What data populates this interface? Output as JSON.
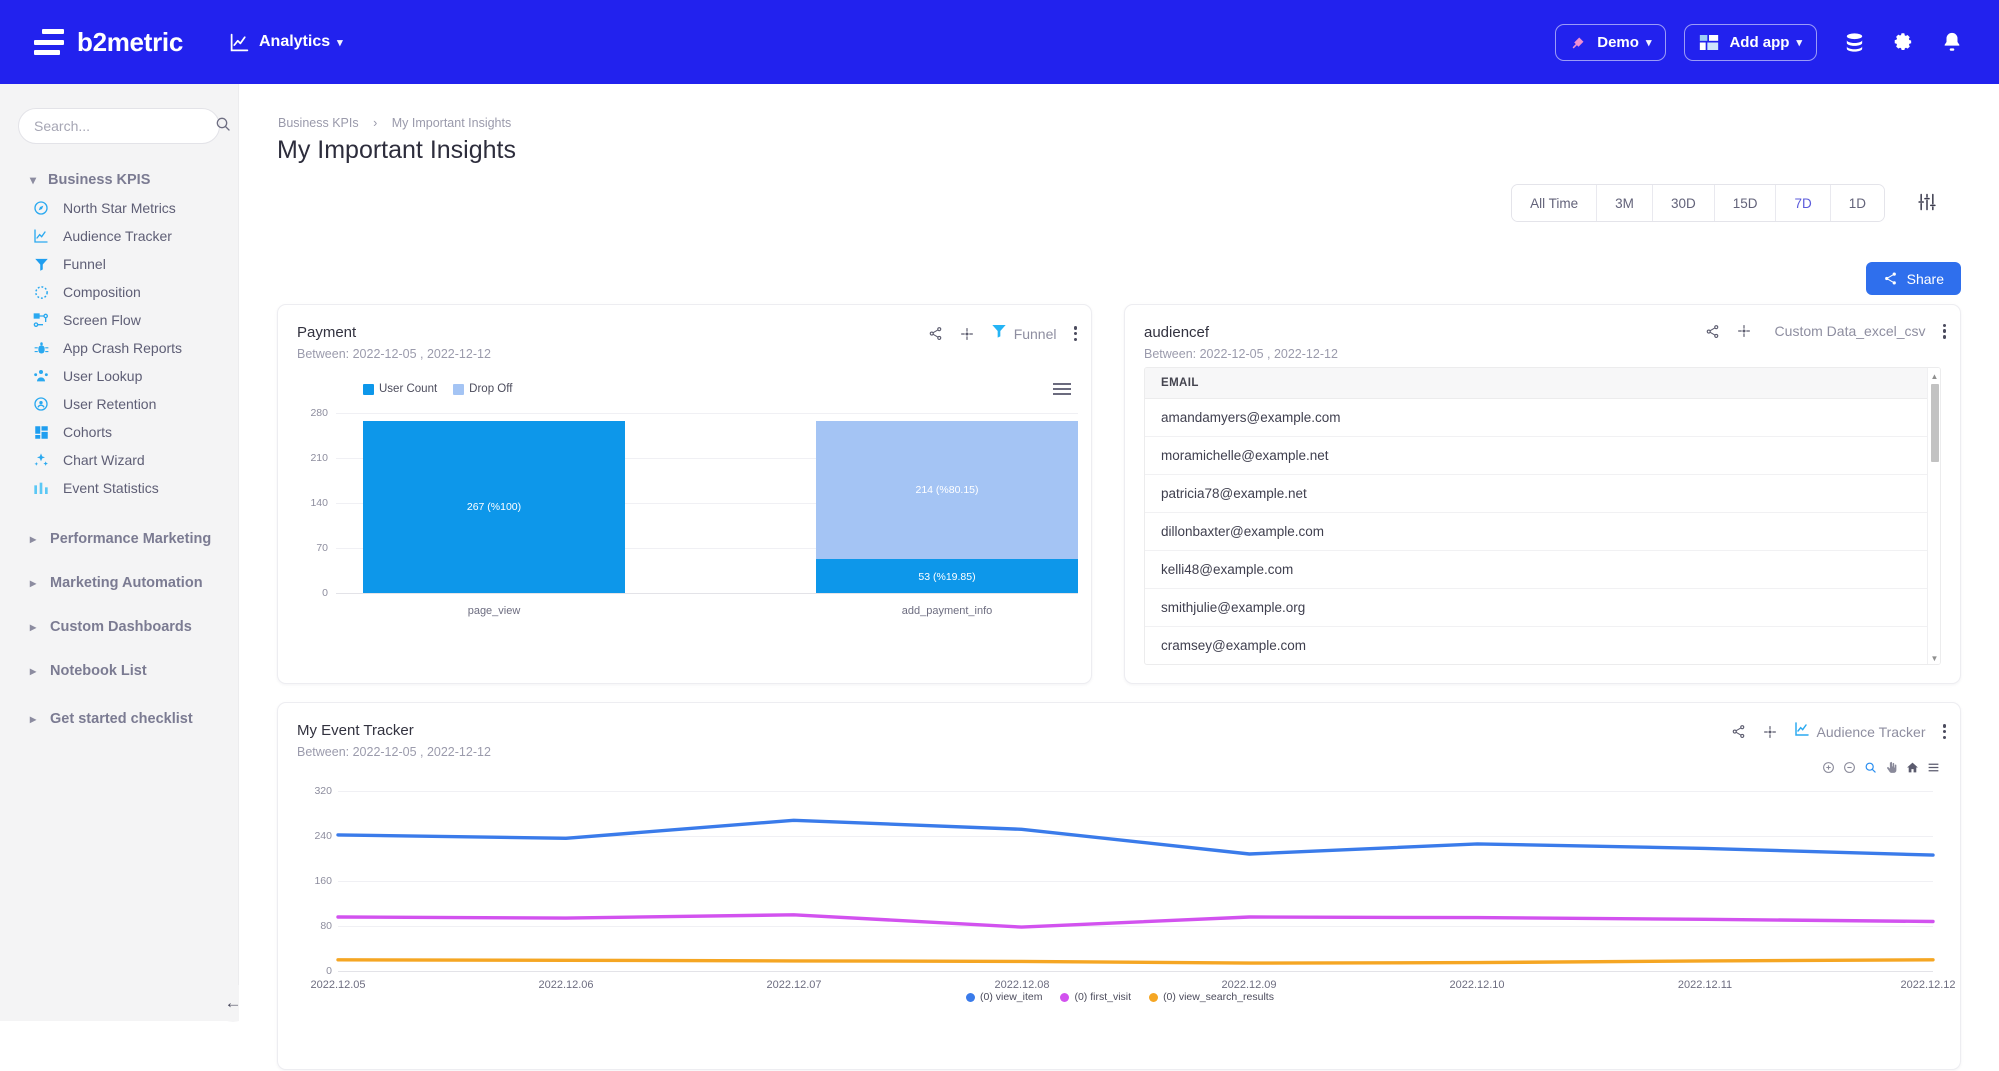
{
  "topbar": {
    "brand": "b2metric",
    "analytics_label": "Analytics",
    "analytics_icon": "line-chart-icon",
    "demo_label": "Demo",
    "demo_icon": "rocket-icon",
    "add_app_label": "Add app",
    "add_app_icon": "apps-grid-icon",
    "database_icon": "database-icon",
    "settings_icon": "gear-icon",
    "notifications_icon": "bell-icon",
    "brand_color": "#2222EE"
  },
  "sidebar": {
    "search_placeholder": "Search...",
    "search_value": "",
    "search_icon": "search-icon",
    "group_label": "Business KPIS",
    "items": [
      {
        "label": "North Star Metrics",
        "icon": "compass-icon"
      },
      {
        "label": "Audience Tracker",
        "icon": "line-chart-icon"
      },
      {
        "label": "Funnel",
        "icon": "funnel-icon"
      },
      {
        "label": "Composition",
        "icon": "composition-icon"
      },
      {
        "label": "Screen Flow",
        "icon": "flow-nodes-icon"
      },
      {
        "label": "App Crash Reports",
        "icon": "bug-icon"
      },
      {
        "label": "User Lookup",
        "icon": "users-icon"
      },
      {
        "label": "User Retention",
        "icon": "user-retention-icon"
      },
      {
        "label": "Cohorts",
        "icon": "cohorts-grid-icon"
      },
      {
        "label": "Chart Wizard",
        "icon": "wizard-sparkle-icon"
      },
      {
        "label": "Event Statistics",
        "icon": "bar-stats-icon"
      }
    ],
    "sections": [
      {
        "label": "Performance Marketing"
      },
      {
        "label": "Marketing Automation"
      },
      {
        "label": "Custom Dashboards"
      },
      {
        "label": "Notebook List"
      },
      {
        "label": "Get started checklist"
      }
    ],
    "collapse_icon": "arrow-left-icon"
  },
  "header": {
    "breadcrumb_root": "Business KPIs",
    "breadcrumb_current": "My Important Insights",
    "title": "My Important Insights",
    "share_label": "Share",
    "share_icon": "share-icon",
    "range_settings_icon": "sliders-icon",
    "ranges": [
      {
        "label": "All Time",
        "active": false
      },
      {
        "label": "3M",
        "active": false
      },
      {
        "label": "30D",
        "active": false
      },
      {
        "label": "15D",
        "active": false
      },
      {
        "label": "7D",
        "active": true
      },
      {
        "label": "1D",
        "active": false
      }
    ],
    "active_range_color": "#5b5bdb"
  },
  "cards": {
    "payment": {
      "title": "Payment",
      "subtitle": "Between: 2022-12-05 , 2022-12-12",
      "type_label": "Funnel",
      "type_icon": "funnel-icon",
      "share_icon": "share-icon",
      "move_icon": "drag-handle-icon",
      "menu_icon": "kebab-menu-icon",
      "chart_menu_icon": "hamburger-menu-icon"
    },
    "audience": {
      "title": "audiencef",
      "subtitle": "Between: 2022-12-05 , 2022-12-12",
      "type_label": "Custom Data_excel_csv",
      "share_icon": "share-icon",
      "move_icon": "drag-handle-icon",
      "menu_icon": "kebab-menu-icon",
      "column_header": "EMAIL",
      "rows": [
        "amandamyers@example.com",
        "moramichelle@example.net",
        "patricia78@example.net",
        "dillonbaxter@example.com",
        "kelli48@example.com",
        "smithjulie@example.org",
        "cramsey@example.com"
      ]
    },
    "events": {
      "title": "My Event Tracker",
      "subtitle": "Between: 2022-12-05 , 2022-12-12",
      "type_label": "Audience Tracker",
      "type_icon": "line-chart-icon",
      "share_icon": "share-icon",
      "move_icon": "drag-handle-icon",
      "menu_icon": "kebab-menu-icon",
      "toolbar_icons": [
        "zoom-in-icon",
        "zoom-out-icon",
        "selection-zoom-icon",
        "panning-icon",
        "reset-home-icon",
        "menu-icon"
      ]
    }
  },
  "chart_data": [
    {
      "type": "bar",
      "title": "Payment",
      "subtitle": "Between: 2022-12-05 , 2022-12-12",
      "categories": [
        "page_view",
        "add_payment_info"
      ],
      "series": [
        {
          "name": "User Count",
          "color": "#0d97ea",
          "values": [
            267,
            53
          ]
        },
        {
          "name": "Drop Off",
          "color": "#a4c4f4",
          "values": [
            0,
            214
          ]
        }
      ],
      "point_labels": [
        {
          "category": "page_view",
          "series": "User Count",
          "text": "267 (%100)"
        },
        {
          "category": "add_payment_info",
          "series": "Drop Off",
          "text": "214 (%80.15)"
        },
        {
          "category": "add_payment_info",
          "series": "User Count",
          "text": "53 (%19.85)"
        }
      ],
      "yticks": [
        0,
        70,
        140,
        210,
        280
      ],
      "ylim": [
        0,
        280
      ],
      "xlabel": "",
      "ylabel": "",
      "grid": true,
      "stacked": true,
      "legend_position": "top-left"
    },
    {
      "type": "line",
      "title": "My Event Tracker",
      "subtitle": "Between: 2022-12-05 , 2022-12-12",
      "x": [
        "2022.12.05",
        "2022.12.06",
        "2022.12.07",
        "2022.12.08",
        "2022.12.09",
        "2022.12.10",
        "2022.12.11",
        "2022.12.12"
      ],
      "series": [
        {
          "name": "(0) view_item",
          "color": "#3a7bea",
          "values": [
            242,
            236,
            268,
            252,
            208,
            226,
            218,
            206
          ]
        },
        {
          "name": "(0) first_visit",
          "color": "#d252ef",
          "values": [
            96,
            94,
            100,
            78,
            96,
            95,
            92,
            88
          ]
        },
        {
          "name": "(0) view_search_results",
          "color": "#f5a623",
          "values": [
            20,
            19,
            18,
            17,
            14,
            15,
            18,
            20
          ]
        }
      ],
      "yticks": [
        0,
        80,
        160,
        240,
        320
      ],
      "ylim": [
        0,
        320
      ],
      "xlabel": "",
      "ylabel": "",
      "grid": true,
      "legend_position": "bottom-center"
    }
  ]
}
